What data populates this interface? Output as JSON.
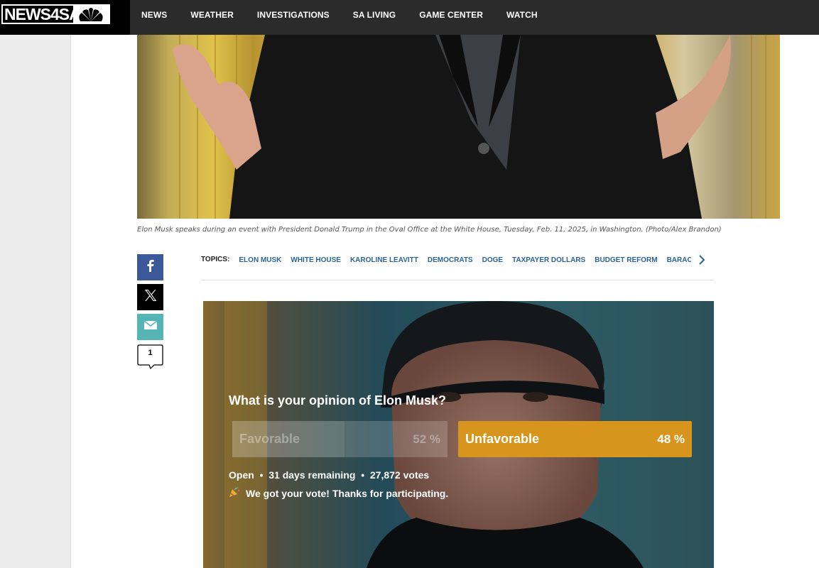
{
  "header": {
    "logo_text": "NEWS4SA",
    "nav": [
      "NEWS",
      "WEATHER",
      "INVESTIGATIONS",
      "SA LIVING",
      "GAME CENTER",
      "WATCH"
    ]
  },
  "article": {
    "caption": "Elon Musk speaks during an event with President Donald Trump in the Oval Office at the White House, Tuesday, Feb. 11, 2025, in Washington. (Photo/Alex Brandon)",
    "comment_count": "1"
  },
  "topics": {
    "label": "TOPICS:",
    "items": [
      "ELON MUSK",
      "WHITE HOUSE",
      "KAROLINE LEAVITT",
      "DEMOCRATS",
      "DOGE",
      "TAXPAYER DOLLARS",
      "BUDGET REFORM",
      "BARACK"
    ]
  },
  "poll": {
    "question": "What is your opinion of Elon Musk?",
    "options": [
      {
        "label": "Favorable",
        "percent": "52 %",
        "share": 0.52,
        "selected": false
      },
      {
        "label": "Unfavorable",
        "percent": "48 %",
        "share": 0.48,
        "selected": true
      }
    ],
    "status": "Open",
    "remaining": "31 days remaining",
    "votes": "27,872 votes",
    "thanks": "We got your vote! Thanks for participating.",
    "accent_color": "#d8951e"
  },
  "icons": [
    "peacock-logo-icon",
    "facebook-icon",
    "x-icon",
    "email-icon",
    "comment-icon",
    "chevron-right-icon",
    "party-popper-icon"
  ]
}
